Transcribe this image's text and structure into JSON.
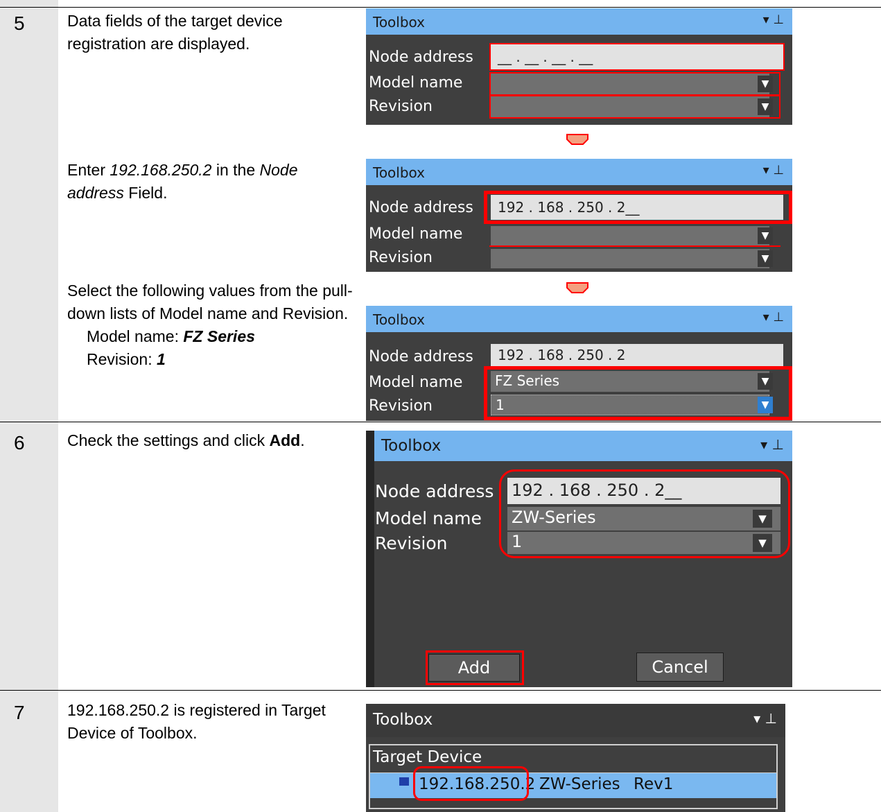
{
  "steps": [
    {
      "number": "5",
      "desc_a": "Data fields of the target device registration are displayed.",
      "desc_b_enter": "Enter ",
      "desc_b_value": "192.168.250.2",
      "desc_b_in_the": " in the ",
      "desc_b_field_name": "Node address",
      "desc_b_field": " Field.",
      "desc_c": "Select the following values from the pull-down lists of Model name and Revision.",
      "model_label": "Model name: ",
      "model_value": "FZ Series",
      "rev_label": "Revision: ",
      "rev_value": "1"
    },
    {
      "number": "6",
      "desc_a": "Check the settings and click ",
      "desc_bold": "Add",
      "desc_end": "."
    },
    {
      "number": "7",
      "desc": "192.168.250.2 is registered in Target Device of Toolbox."
    }
  ],
  "toolbox": {
    "title": "Toolbox",
    "pin_glyph": "▾ ⊥",
    "node_label": "Node address",
    "model_label": "Model name",
    "revision_label": "Revision",
    "empty_ip": "__ . __ . __ . __",
    "ip_typed": "192 . 168 . 250 . 2__",
    "ip_entered": "192 . 168 . 250 . 2",
    "model_fz": "FZ Series",
    "model_zw": "ZW-Series",
    "revision_value": "1",
    "add_button": "Add",
    "cancel_button": "Cancel",
    "target_device_header": "Target Device",
    "device_ip": "192.168.250.2",
    "device_model": "ZW-Series",
    "device_rev": "Rev1"
  },
  "colors": {
    "panel_bg": "#3f3f3f",
    "header_blue": "#74b4ef",
    "highlight_red": "#ff0000",
    "arrow_fill": "#f4a080",
    "step_column": "#e6e6e6",
    "selection_blue": "#7ab8f0"
  }
}
